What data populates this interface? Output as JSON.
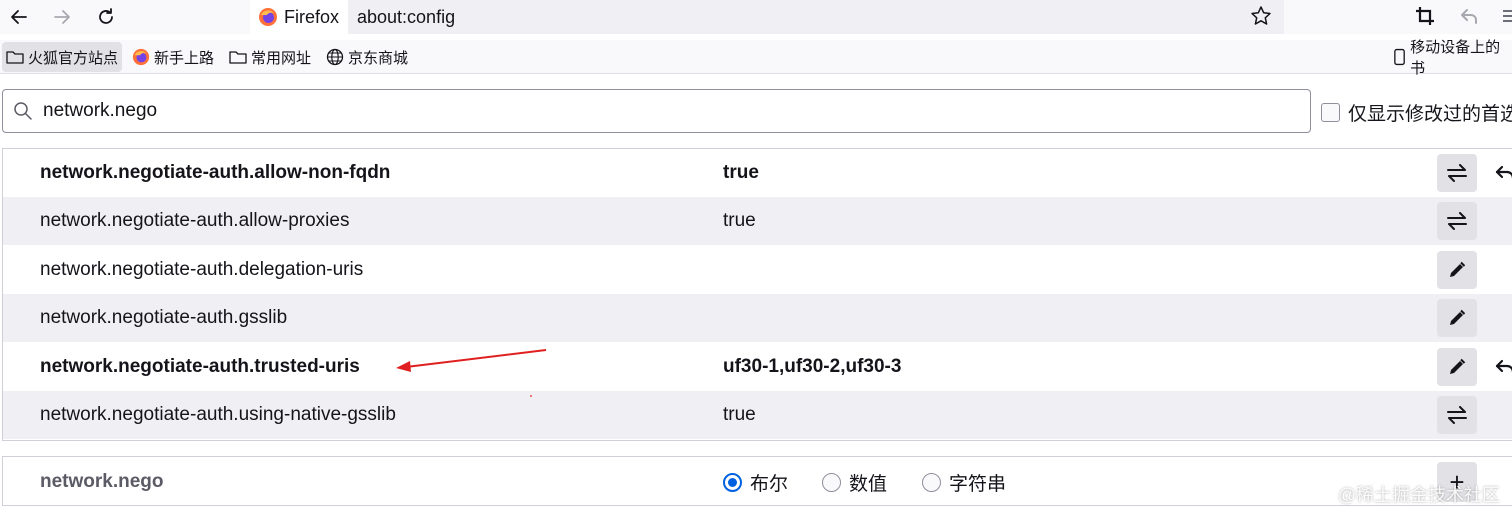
{
  "toolbar": {
    "identity_label": "Firefox",
    "url": "about:config"
  },
  "bookmarks": [
    {
      "label": "火狐官方站点",
      "icon": "folder-icon"
    },
    {
      "label": "新手上路",
      "icon": "firefox-icon"
    },
    {
      "label": "常用网址",
      "icon": "folder-icon"
    },
    {
      "label": "京东商城",
      "icon": "globe-icon"
    }
  ],
  "mobile_bookmarks": {
    "label": "移动设备上的书",
    "icon": "mobile-icon"
  },
  "search": {
    "value": "network.nego",
    "show_modified_label": "仅显示修改过的首选"
  },
  "prefs": [
    {
      "name": "network.negotiate-auth.allow-non-fqdn",
      "value": "true",
      "modified": true,
      "action": "toggle"
    },
    {
      "name": "network.negotiate-auth.allow-proxies",
      "value": "true",
      "modified": false,
      "action": "toggle"
    },
    {
      "name": "network.negotiate-auth.delegation-uris",
      "value": "",
      "modified": false,
      "action": "edit"
    },
    {
      "name": "network.negotiate-auth.gsslib",
      "value": "",
      "modified": false,
      "action": "edit"
    },
    {
      "name": "network.negotiate-auth.trusted-uris",
      "value": "uf30-1,uf30-2,uf30-3",
      "modified": true,
      "action": "edit"
    },
    {
      "name": "network.negotiate-auth.using-native-gsslib",
      "value": "true",
      "modified": false,
      "action": "toggle"
    }
  ],
  "add_pref": {
    "name": "network.nego",
    "types": [
      {
        "label": "布尔",
        "checked": true
      },
      {
        "label": "数值",
        "checked": false
      },
      {
        "label": "字符串",
        "checked": false
      }
    ],
    "add_label": "+"
  },
  "watermark": "@稀土掘金技术社区",
  "colors": {
    "accent": "#0061e0",
    "annotation_arrow": "#e02020"
  }
}
